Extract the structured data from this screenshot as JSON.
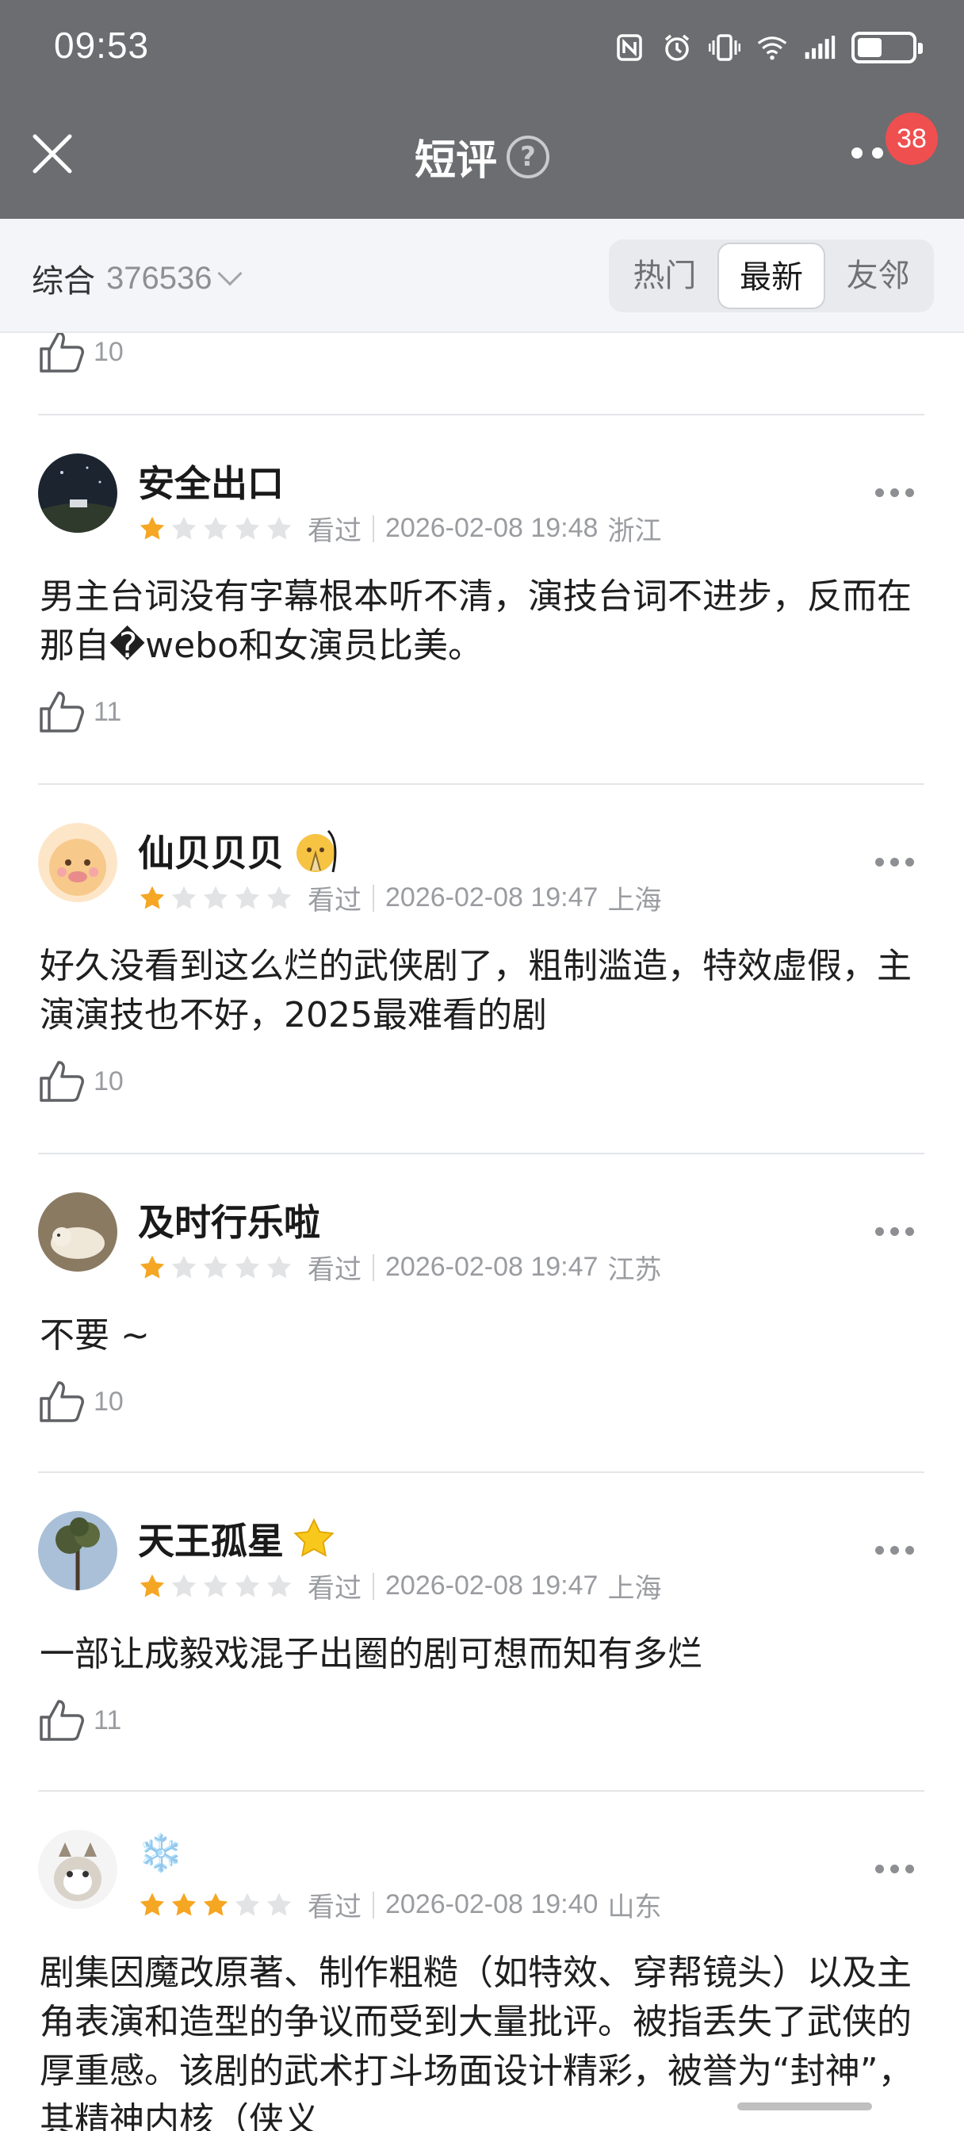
{
  "status_bar": {
    "time": "09:53",
    "icons": [
      "nfc-icon",
      "alarm-icon",
      "vibrate-icon",
      "wifi-icon",
      "signal-icon",
      "battery-icon"
    ]
  },
  "nav": {
    "title": "短评",
    "help": "?",
    "badge": "38"
  },
  "filter": {
    "sort_label": "综合",
    "count": "376536",
    "tabs": [
      "热门",
      "最新",
      "友邻"
    ],
    "active_tab": "最新"
  },
  "previous_item": {
    "likes": "10"
  },
  "reviews": [
    {
      "user": "安全出口",
      "stars": 1,
      "status": "看过",
      "time": "2026-02-08 19:48",
      "location": "浙江",
      "content": "男主台词没有字幕根本听不清，演技台词不进步，反而在那自�webo和女演员比美。",
      "likes": "11"
    },
    {
      "user": "仙贝贝贝",
      "stars": 1,
      "status": "看过",
      "time": "2026-02-08 19:47",
      "location": "上海",
      "content": "好久没看到这么烂的武侠剧了，粗制滥造，特效虚假，主演演技也不好，2025最难看的剧",
      "likes": "10"
    },
    {
      "user": "及时行乐啦",
      "stars": 1,
      "status": "看过",
      "time": "2026-02-08 19:47",
      "location": "江苏",
      "content": "不要 ~",
      "likes": "10"
    },
    {
      "user": "天王孤星",
      "stars": 1,
      "status": "看过",
      "time": "2026-02-08 19:47",
      "location": "上海",
      "content": "一部让成毅戏混子出圈的剧可想而知有多烂",
      "likes": "11"
    },
    {
      "user": "❄️",
      "stars": 3,
      "status": "看过",
      "time": "2026-02-08 19:40",
      "location": "山东",
      "content": "剧集因魔改原著、制作粗糙（如特效、穿帮镜头）以及主角表演和造型的争议而受到大量批评。被指丢失了武侠的厚重感。该剧的武术打斗场面设计精彩，被誉为“封神”，其精神内核（侠义"
    }
  ],
  "colors": {
    "topbar": "#6b6d70",
    "star_on": "#f5a623",
    "star_off": "#e2e3e5",
    "badge": "#ef4f4f"
  }
}
